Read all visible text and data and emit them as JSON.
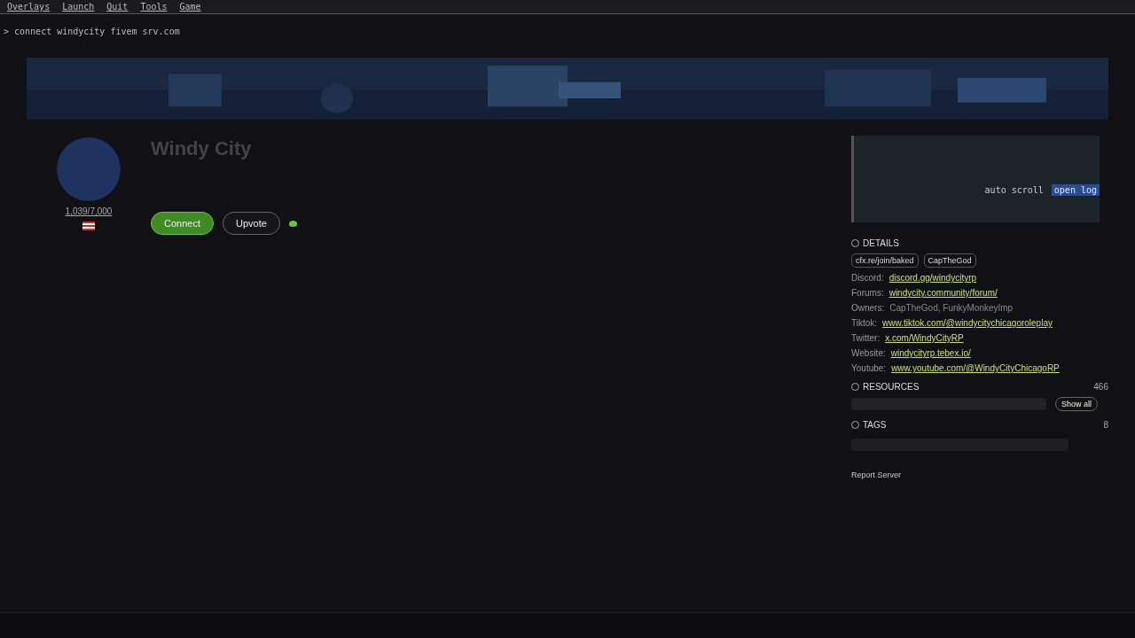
{
  "menu": [
    "Overlays",
    "Launch",
    "Quit",
    "Tools",
    "Game"
  ],
  "console": {
    "line": "> connect windycity fivem srv.com",
    "actions": [
      {
        "label": "auto scroll",
        "selected": false
      },
      {
        "label": "open log",
        "selected": true
      }
    ]
  },
  "server": {
    "name": "Windy City",
    "players": "1,039/7,000",
    "buttons": [
      {
        "label": "Connect",
        "kind": "primary"
      },
      {
        "label": "Upvote",
        "kind": "outline"
      }
    ]
  },
  "details": {
    "title": "DETAILS",
    "chips": [
      "cfx.re/join/baked",
      "CapTheGod"
    ],
    "rows": [
      {
        "label": "Discord:",
        "value": "discord.gg/windycityrp",
        "kind": "link"
      },
      {
        "label": "Forums:",
        "value": "windycity.community/forum/",
        "kind": "link"
      },
      {
        "label": "Owners:",
        "value": "CapTheGod, FunkyMonkeyImp",
        "kind": "text"
      },
      {
        "label": "Tiktok:",
        "value": "www.tiktok.com/@windycitychicagoroleplay",
        "kind": "link"
      },
      {
        "label": "Twitter:",
        "value": "x.com/WindyCityRP",
        "kind": "link"
      },
      {
        "label": "Website:",
        "value": "windycityrp.tebex.io/",
        "kind": "link"
      },
      {
        "label": "Youtube:",
        "value": "www.youtube.com/@WindyCityChicagoRP",
        "kind": "link"
      }
    ]
  },
  "resources": {
    "title": "RESOURCES",
    "count": "466",
    "button": "Show all"
  },
  "tags": {
    "title": "TAGS",
    "count": "8"
  },
  "report": "Report Server"
}
